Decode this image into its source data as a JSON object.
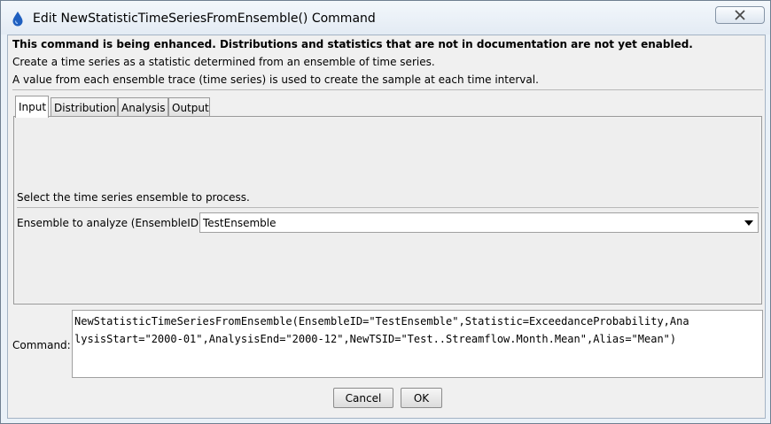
{
  "window": {
    "title": "Edit NewStatisticTimeSeriesFromEnsemble() Command"
  },
  "header": {
    "bold_note": "This command is being enhanced. Distributions and statistics that are not in documentation are not yet enabled.",
    "line1": "Create a time series as a statistic determined from an ensemble of time series.",
    "line2": "A value from each ensemble trace (time series) is used to create the sample at each time interval."
  },
  "tabs": [
    {
      "label": "Input",
      "active": true
    },
    {
      "label": "Distribution",
      "active": false
    },
    {
      "label": "Analysis",
      "active": false
    },
    {
      "label": "Output",
      "active": false
    }
  ],
  "input_panel": {
    "instruction": "Select the time series ensemble to process.",
    "ensemble_label": "Ensemble to analyze (EnsembleID):",
    "ensemble_value": "TestEnsemble"
  },
  "command": {
    "label": "Command:",
    "text": "NewStatisticTimeSeriesFromEnsemble(EnsembleID=\"TestEnsemble\",Statistic=ExceedanceProbability,AnalysisStart=\"2000-01\",AnalysisEnd=\"2000-12\",NewTSID=\"Test..Streamflow.Month.Mean\",Alias=\"Mean\")",
    "line1": "NewStatisticTimeSeriesFromEnsemble(EnsembleID=\"TestEnsemble\",Statistic=ExceedanceProbability,Ana",
    "line2": "lysisStart=\"2000-01\",AnalysisEnd=\"2000-12\",NewTSID=\"Test..Streamflow.Month.Mean\",Alias=\"Mean\")"
  },
  "buttons": {
    "cancel": "Cancel",
    "ok": "OK"
  },
  "icons": {
    "app": "water-drop-icon",
    "close": "close-icon",
    "dropdown": "chevron-down-icon"
  }
}
